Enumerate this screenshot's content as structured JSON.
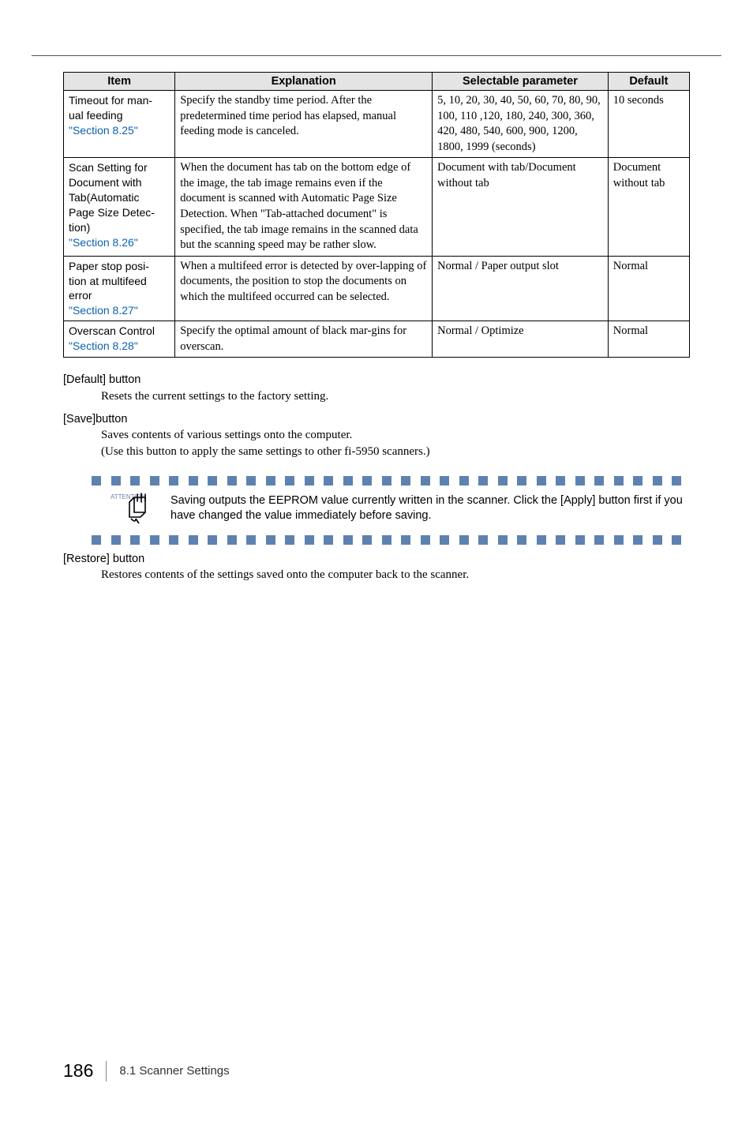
{
  "table": {
    "headers": {
      "item": "Item",
      "explanation": "Explanation",
      "selectable": "Selectable parameter",
      "default": "Default"
    },
    "rows": [
      {
        "item_lines": [
          "Timeout for man-",
          "ual feeding"
        ],
        "section": "\"Section 8.25\"",
        "explanation": "Specify the standby time period. After the predetermined time period has elapsed, manual feeding mode is canceled.",
        "selectable": "5, 10, 20, 30, 40, 50, 60, 70, 80, 90, 100, 110 ,120, 180, 240, 300, 360, 420, 480, 540, 600, 900, 1200, 1800, 1999 (seconds)",
        "default": "10 seconds"
      },
      {
        "item_lines": [
          "Scan Setting for",
          "Document with",
          "Tab(Automatic",
          "Page Size Detec-",
          "tion)"
        ],
        "section": "\"Section 8.26\"",
        "explanation": "When the document has tab on the bottom edge of the image, the tab image remains even if the document is scanned with Automatic Page Size Detection. When \"Tab-attached document\" is specified, the tab image remains in the scanned data but the scanning speed may be rather slow.",
        "selectable": "Document with tab/Document without tab",
        "default": "Document without tab"
      },
      {
        "item_lines": [
          "Paper stop posi-",
          "tion at multifeed",
          "error"
        ],
        "section": "\"Section 8.27\"",
        "explanation": "When a multifeed error is detected by over-lapping of documents, the position to stop the documents on which the multifeed occurred can be selected.",
        "selectable": "Normal / Paper output slot",
        "default": "Normal"
      },
      {
        "item_lines": [
          "Overscan Control"
        ],
        "section": "\"Section 8.28\"",
        "explanation": "Specify the optimal amount of black mar-gins for overscan.",
        "selectable": "Normal / Optimize",
        "default": "Normal"
      }
    ]
  },
  "default_btn": {
    "title": "[Default] button",
    "desc": "Resets the current settings to the factory setting."
  },
  "save_btn": {
    "title": "[Save]button",
    "desc1": "Saves contents of various settings onto the computer.",
    "desc2": "(Use this button to apply the same settings to other fi-5950 scanners.)"
  },
  "attention": {
    "label": "ATTENTION",
    "text": "Saving outputs the EEPROM value currently written in the scanner. Click the [Apply] button first if you have changed the value immediately before saving."
  },
  "restore_btn": {
    "title": "[Restore] button",
    "desc": "Restores contents of the settings saved onto the computer back to the scanner."
  },
  "footer": {
    "page": "186",
    "section": "8.1 Scanner Settings"
  }
}
